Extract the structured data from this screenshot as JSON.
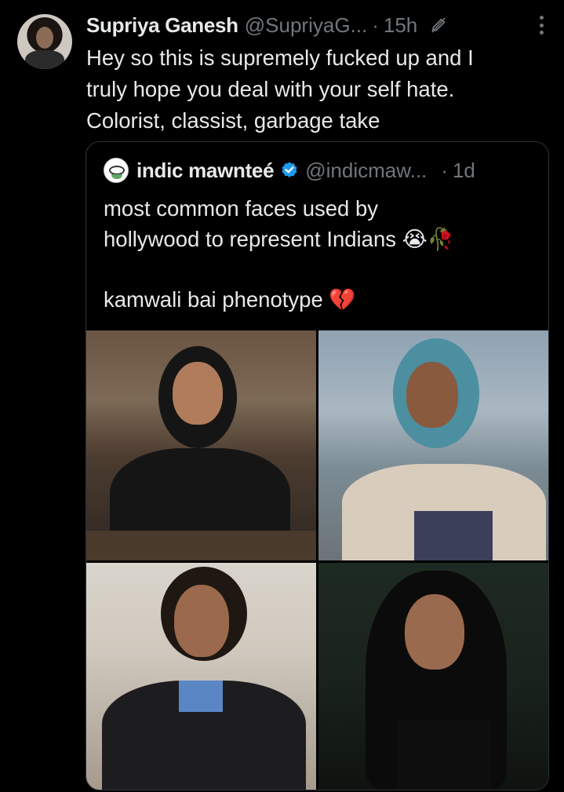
{
  "tweet": {
    "author_name": "Supriya Ganesh",
    "author_handle": "@SupriyaG...",
    "separator": "·",
    "time": "15h",
    "text": "Hey so this is supremely fucked up and I\ntruly hope you deal with your self hate.\nColorist, classist, garbage take"
  },
  "quoted": {
    "author_name": "indic mawnteé",
    "author_handle": "@indicmaw...",
    "separator": "·",
    "time": "1d",
    "text": "most common faces used by\nhollywood to represent Indians 😭🥀\n\nkamwali bai phenotype 💔",
    "photos": [
      "photo-1",
      "photo-2",
      "photo-3",
      "photo-4"
    ]
  },
  "icons": {
    "edited": "edit-pencil-icon",
    "more": "more-options-icon",
    "verified": "verified-badge-icon"
  },
  "colors": {
    "background": "#000000",
    "text": "#e7e9ea",
    "secondary": "#71767b",
    "border": "#2f3336",
    "verified": "#1d9bf0"
  }
}
